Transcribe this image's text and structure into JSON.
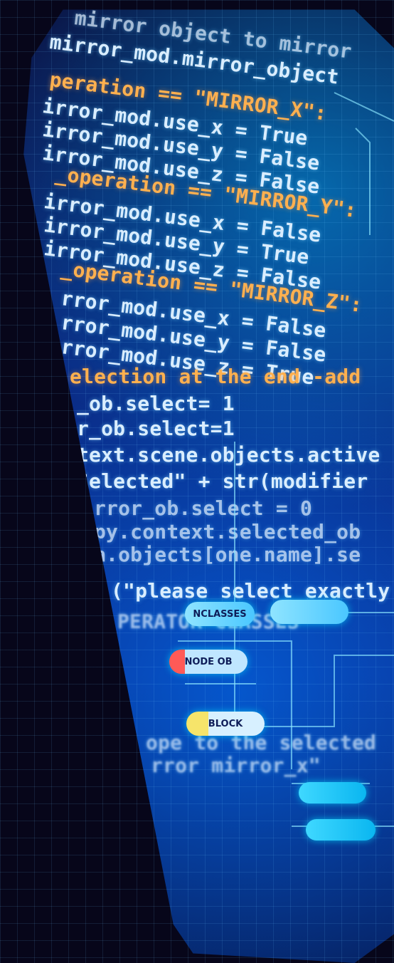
{
  "hero": {
    "code_lines": [
      "mirror object to mirror",
      "mirror_mod.mirror_object",
      "peration == \"MIRROR_X\":",
      "irror_mod.use_x = True",
      "irror_mod.use_y = False",
      "irror_mod.use_z = False",
      "_operation == \"MIRROR_Y\":",
      "irror_mod.use_x = False",
      "irror_mod.use_y = True",
      "irror_mod.use_z = False",
      "_operation == \"MIRROR_Z\":",
      "rror_mod.use_x = False",
      "rror_mod.use_y = False",
      "rror_mod.use_z = True",
      "election at the end -add",
      "_ob.select= 1",
      "r_ob.select=1",
      "text.scene.objects.active",
      "Selected\" + str(modifier",
      "rror_ob.select = 0",
      "py.context.selected_ob",
      "a.objects[one.name].se",
      "(\"please select exactly",
      "PERATOR CLASSES",
      "ope to the selected",
      "rror mirror_x\""
    ],
    "nodes": {
      "node_classes": "NCLASSES",
      "node_ob": "NODE OB",
      "node_block": "BLOCK"
    }
  }
}
